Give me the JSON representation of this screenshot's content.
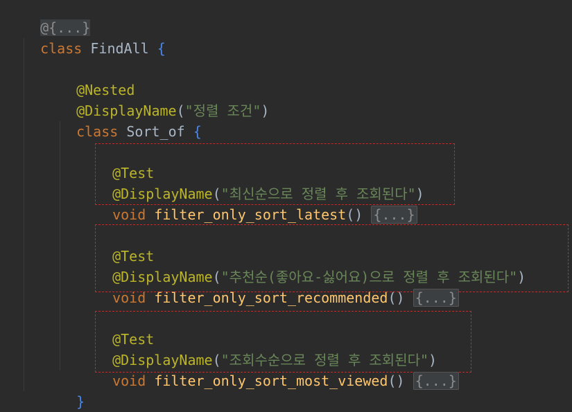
{
  "editor": {
    "folded_annotation": "@{...}",
    "outer_class": {
      "keyword": "class",
      "name": "FindAll",
      "open": "{"
    },
    "nested": {
      "annotation_nested": "@Nested",
      "display_name_ann": "@DisplayName",
      "display_name_value": "\"정렬 조건\"",
      "keyword": "class",
      "name": "Sort_of",
      "open": "{",
      "close": "}"
    },
    "tests": [
      {
        "annotation": "@Test",
        "display_name_ann": "@DisplayName",
        "display_name_value": "\"최신순으로 정렬 후 조회된다\"",
        "return_type": "void",
        "method": "filter_only_sort_latest",
        "params": "()",
        "body": "{...}"
      },
      {
        "annotation": "@Test",
        "display_name_ann": "@DisplayName",
        "display_name_value": "\"추천순(좋아요-싫어요)으로 정렬 후 조회된다\"",
        "return_type": "void",
        "method": "filter_only_sort_recommended",
        "params": "()",
        "body": "{...}"
      },
      {
        "annotation": "@Test",
        "display_name_ann": "@DisplayName",
        "display_name_value": "\"조회수순으로 정렬 후 조회된다\"",
        "return_type": "void",
        "method": "filter_only_sort_most_viewed",
        "params": "()",
        "body": "{...}"
      }
    ]
  }
}
